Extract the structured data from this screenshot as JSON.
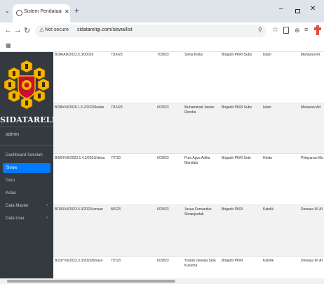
{
  "browser": {
    "tab_title": "Sistem Pendataan Data Pelajar",
    "url_security": "Not secure",
    "url": "sidatareligi.com/siswa/list",
    "colors": {
      "tabstrip": "#dfe3ea",
      "omnibox": "#f1f3f4"
    }
  },
  "sidebar": {
    "brand": "SIDATARELIGI",
    "user": "admin",
    "items": [
      {
        "label": "Dashboard Sekolah",
        "active": false
      },
      {
        "label": "Siswa",
        "active": true
      },
      {
        "label": "Guru",
        "active": false
      },
      {
        "label": "Kelas",
        "active": false
      },
      {
        "label": "Data Master",
        "active": false,
        "has_submenu": true
      },
      {
        "label": "Data User",
        "active": false,
        "has_submenu": true
      }
    ],
    "colors": {
      "background": "#343a40",
      "active": "#007bff"
    }
  },
  "table": {
    "rows": [
      {
        "id": "B/3A/AD/2023.5.3/00016",
        "date1": "7/14/23",
        "date2": "7/28/23",
        "name": "Sintia Rizky",
        "office": "Brigadir PKRI Subs",
        "religion": "Islam",
        "last": "Maharani Ri"
      },
      {
        "id": "B/39b/VI/2026.1.5.2/2023/ketan",
        "date1": "7/15/23",
        "date2": "6/29/23",
        "name": "Muhammad Jaidan Rendra",
        "office": "Brigadir PKRI Subs",
        "religion": "Islam",
        "last": "Maharani Ad"
      },
      {
        "id": "B/564/VII/2023.1.4.3/2023/stima",
        "date1": "7/7/23",
        "date2": "6/28/23",
        "name": "Putu Agus Aditia Mandala",
        "office": "Brigadir PKRI Sete",
        "religion": "Hindu",
        "last": "Pelayanan Ma"
      },
      {
        "id": "B/193/VI/2023.5.3/2023/umsan",
        "date1": "8/6/23",
        "date2": "6/29/23",
        "name": "Josua Fernandus Simanjuntak",
        "office": "Brigadir PKRI",
        "religion": "Katolik",
        "last": "Dewasa IIII AI"
      },
      {
        "id": "B/237/VI/2023.3.3/2023/kinaso",
        "date1": "7/7/23",
        "date2": "6/28/23",
        "name": "Yosiah Dewata Sela Kusuma",
        "office": "Brigadir PKRI",
        "religion": "Katolik",
        "last": "Dewasa IIII AI"
      }
    ]
  }
}
